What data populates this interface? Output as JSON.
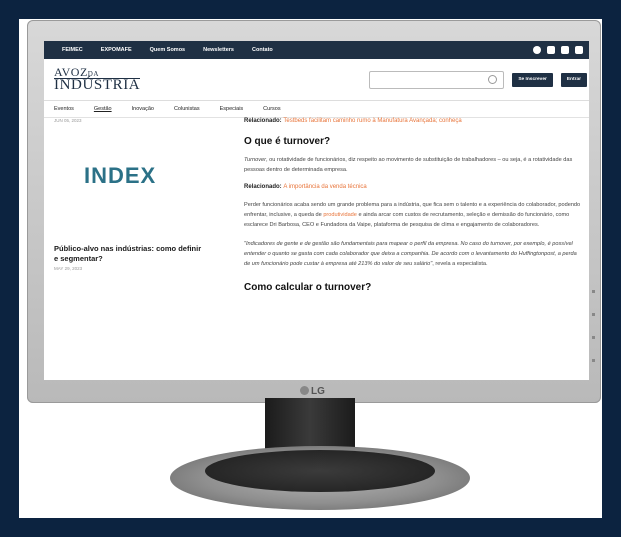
{
  "topnav": {
    "items": [
      "FEIMEC",
      "EXPOMAFE",
      "Quem Somos",
      "Newsletters",
      "Contato"
    ],
    "social_icons": [
      "facebook-icon",
      "instagram-icon",
      "linkedin-icon",
      "youtube-icon"
    ]
  },
  "brand": {
    "line1": "AVOZ",
    "line1_small": "DA",
    "line2": "INDÚSTRIA"
  },
  "header": {
    "search_placeholder": "",
    "subscribe_label": "Se Inscrever",
    "login_label": "Entrar"
  },
  "catnav": {
    "items": [
      "Eventos",
      "Gestão",
      "Inovação",
      "Colunistas",
      "Especiais",
      "Cursos"
    ],
    "active": "Gestão"
  },
  "sidebar": {
    "date_top": "JUN 05, 2023",
    "banner": "INDEX",
    "headline": "Público-alvo nas indústrias: como definir e segmentar?",
    "headline_date": "MAY 29, 2023"
  },
  "article": {
    "related1_prefix": "Relacionado:",
    "related1_link": "Testbeds facilitam caminho rumo à Manufatura Avançada; conheça",
    "h1": "O que é turnover?",
    "p1_em": "Turnover",
    "p1": ", ou rotatividade de funcionários, diz respeito ao movimento de substituição de trabalhadores – ou seja, é a rotatividade das pessoas dentro de determinada empresa.",
    "related2_prefix": "Relacionado:",
    "related2_link": "A importância da venda técnica",
    "p2a": "Perder funcionários acaba sendo um grande problema para a indústria, que fica sem o talento e a experiência do colaborador, podendo enfrentar, inclusive, a queda de ",
    "p2_link": "produtividade",
    "p2b": " e ainda arcar com custos de recrutamento, seleção e demissão do funcionário, como esclarece Dri Barbosa, CEO e Fundadora da Vaipe, plataforma de pesquisa de clima e engajamento de colaboradores.",
    "p3": "\"Indicadores de gente e de gestão são fundamentais para mapear o perfil da empresa. No caso do turnover, por exemplo, é possível entender o quanto se gasta com cada colaborador que deixa a companhia. De acordo com o levantamento do Huffingtonpost, a perda de um funcionário pode custar à empresa até 213% do valor de seu salário\"",
    "p3_tail": ", revela a especialista.",
    "h2": "Como calcular o turnover?"
  },
  "monitor": {
    "brand": "LG"
  }
}
